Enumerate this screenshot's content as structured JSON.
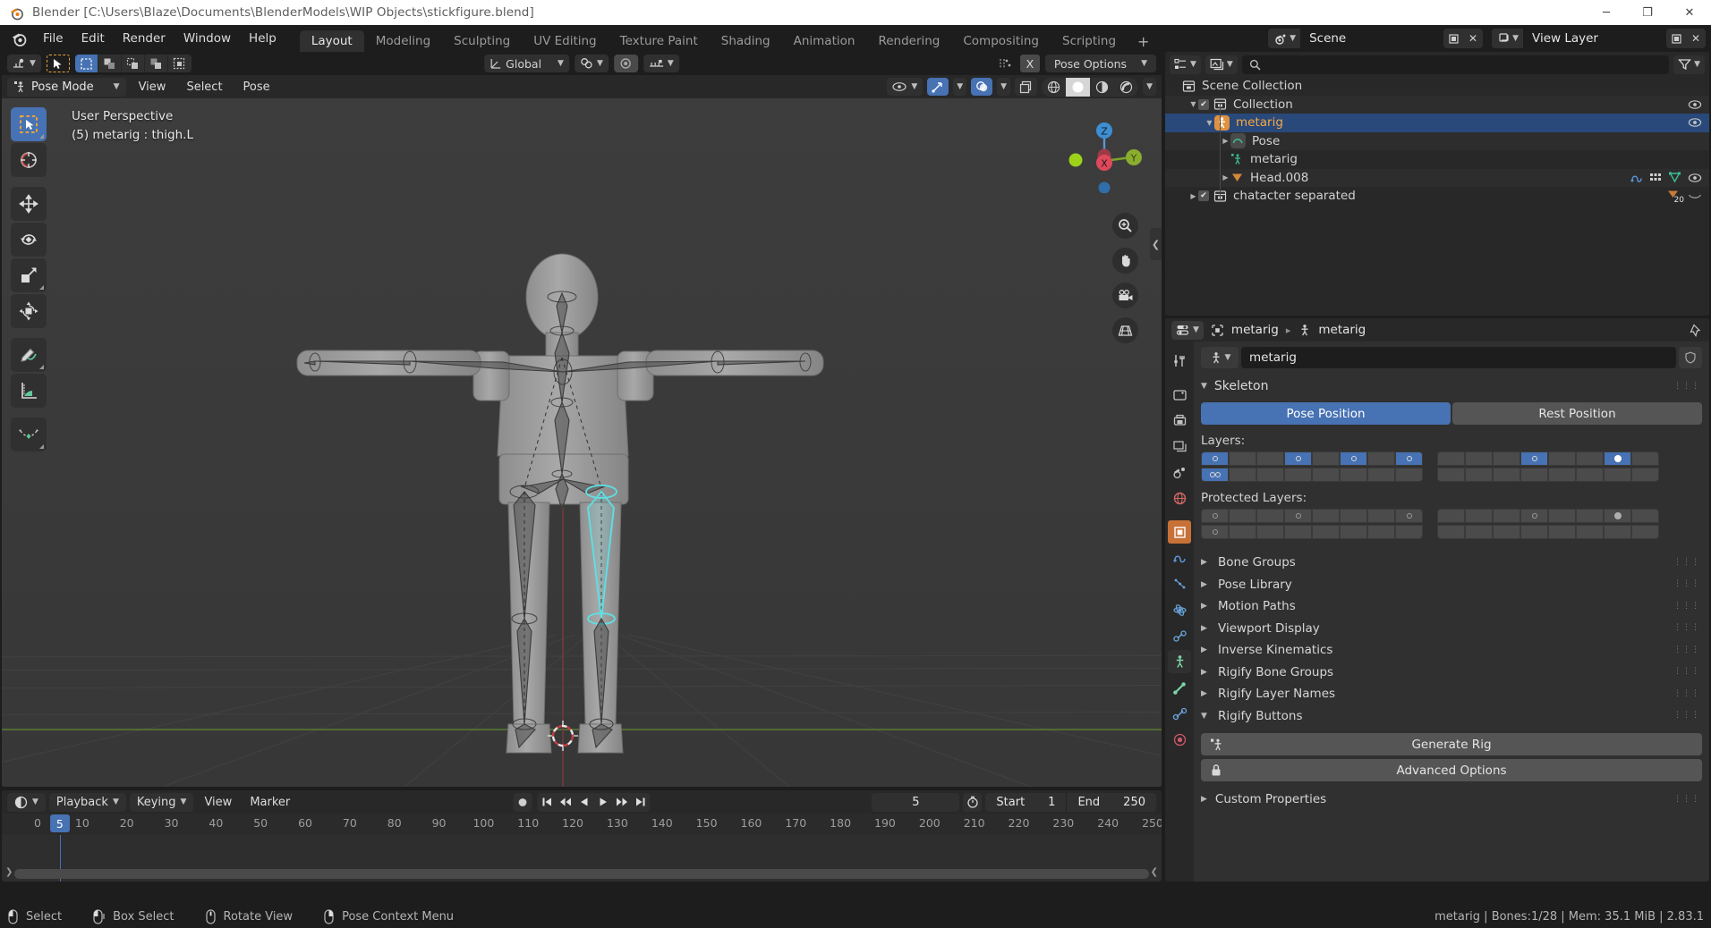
{
  "window": {
    "title": "Blender [C:\\Users\\Blaze\\Documents\\BlenderModels\\WIP Objects\\stickfigure.blend]",
    "minimize": "─",
    "maximize": "❐",
    "close": "✕"
  },
  "topbar": {
    "menus": [
      "File",
      "Edit",
      "Render",
      "Window",
      "Help"
    ],
    "tabs": [
      "Layout",
      "Modeling",
      "Sculpting",
      "UV Editing",
      "Texture Paint",
      "Shading",
      "Animation",
      "Rendering",
      "Compositing",
      "Scripting"
    ],
    "active_tab": "Layout",
    "add_tab": "+",
    "scene_name": "Scene",
    "view_layer_name": "View Layer"
  },
  "viewport": {
    "tool_header": {
      "transform_orientation": "Global",
      "pose_options": "Pose Options",
      "mirror_x": "X"
    },
    "header": {
      "mode": "Pose Mode",
      "menus": [
        "View",
        "Select",
        "Pose"
      ]
    },
    "overlay_text_line1": "User Perspective",
    "overlay_text_line2": "(5) metarig : thigh.L",
    "gizmo_axes": [
      "Z",
      "X",
      "Y"
    ],
    "selection_color": "#5ce1e6"
  },
  "timeline": {
    "menus": [
      "Playback",
      "Keying",
      "View",
      "Marker"
    ],
    "current_frame": "5",
    "start_label": "Start",
    "start_value": "1",
    "end_label": "End",
    "end_value": "250",
    "ticks": [
      "0",
      "5",
      "10",
      "20",
      "30",
      "40",
      "50",
      "60",
      "70",
      "80",
      "90",
      "100",
      "110",
      "120",
      "130",
      "140",
      "150",
      "160",
      "170",
      "180",
      "190",
      "200",
      "210",
      "220",
      "230",
      "240",
      "250"
    ]
  },
  "outliner": {
    "search_placeholder": "",
    "rows": [
      {
        "label": "Scene Collection",
        "indent": 0,
        "icon": "collection-icon",
        "has_tri": false,
        "has_checkbox": false,
        "selected": false,
        "eye": false
      },
      {
        "label": "Collection",
        "indent": 1,
        "icon": "collection-icon",
        "has_tri": true,
        "tri": "▼",
        "has_checkbox": true,
        "selected": false,
        "eye": true
      },
      {
        "label": "metarig",
        "indent": 2,
        "icon": "armature-object-icon",
        "has_tri": true,
        "tri": "▼",
        "has_checkbox": false,
        "selected": true,
        "eye": true
      },
      {
        "label": "Pose",
        "indent": 3,
        "icon": "pose-icon",
        "has_tri": true,
        "tri": "▶",
        "has_checkbox": false,
        "selected": false,
        "eye": false
      },
      {
        "label": "metarig",
        "indent": 3,
        "icon": "armature-data-icon",
        "has_tri": false,
        "has_checkbox": false,
        "selected": false,
        "eye": false
      },
      {
        "label": "Head.008",
        "indent": 3,
        "icon": "mesh-data-icon",
        "has_tri": true,
        "tri": "▶",
        "has_checkbox": false,
        "selected": false,
        "eye": true
      },
      {
        "label": "chatacter separated",
        "indent": 1,
        "icon": "collection-icon",
        "has_tri": true,
        "tri": "▶",
        "has_checkbox": true,
        "selected": false,
        "eye": false,
        "badge": "20"
      }
    ]
  },
  "properties": {
    "breadcrumb": [
      "metarig",
      "metarig"
    ],
    "datablock_name": "metarig",
    "skeleton_panel": "Skeleton",
    "pose_position": "Pose Position",
    "rest_position": "Rest Position",
    "layers_label": "Layers:",
    "protected_layers_label": "Protected Layers:",
    "layers": {
      "left_top": [
        true,
        false,
        false,
        true,
        false,
        true,
        false,
        true
      ],
      "left_bottom": [
        true,
        false,
        false,
        false,
        false,
        false,
        false,
        false
      ],
      "right_top": [
        false,
        false,
        false,
        true,
        false,
        false,
        true,
        false
      ],
      "right_bottom": [
        false,
        false,
        false,
        false,
        false,
        false,
        false,
        false
      ]
    },
    "layers_filled": {
      "left_top": [
        false,
        false,
        false,
        false,
        false,
        false,
        false,
        false
      ],
      "right_top": [
        false,
        false,
        false,
        false,
        false,
        false,
        true,
        false
      ]
    },
    "protected": {
      "left_top": [
        true,
        false,
        false,
        true,
        false,
        false,
        false,
        true
      ],
      "right_top": [
        false,
        false,
        false,
        true,
        false,
        false,
        true,
        false
      ]
    },
    "accordions": [
      "Bone Groups",
      "Pose Library",
      "Motion Paths",
      "Viewport Display",
      "Inverse Kinematics",
      "Rigify Bone Groups",
      "Rigify Layer Names",
      "Rigify Buttons"
    ],
    "rigify_buttons_open": "Rigify Buttons",
    "generate_rig": "Generate Rig",
    "advanced_options": "Advanced Options",
    "custom_properties": "Custom Properties"
  },
  "statusbar": {
    "items": [
      "Select",
      "Box Select",
      "Rotate View",
      "Pose Context Menu"
    ],
    "info": "metarig | Bones:1/28  | Mem: 35.1 MiB | 2.83.1"
  },
  "colors": {
    "accent_blue": "#4772b3",
    "selection_cyan": "#5ce1e6",
    "orange": "#e8a33d"
  }
}
